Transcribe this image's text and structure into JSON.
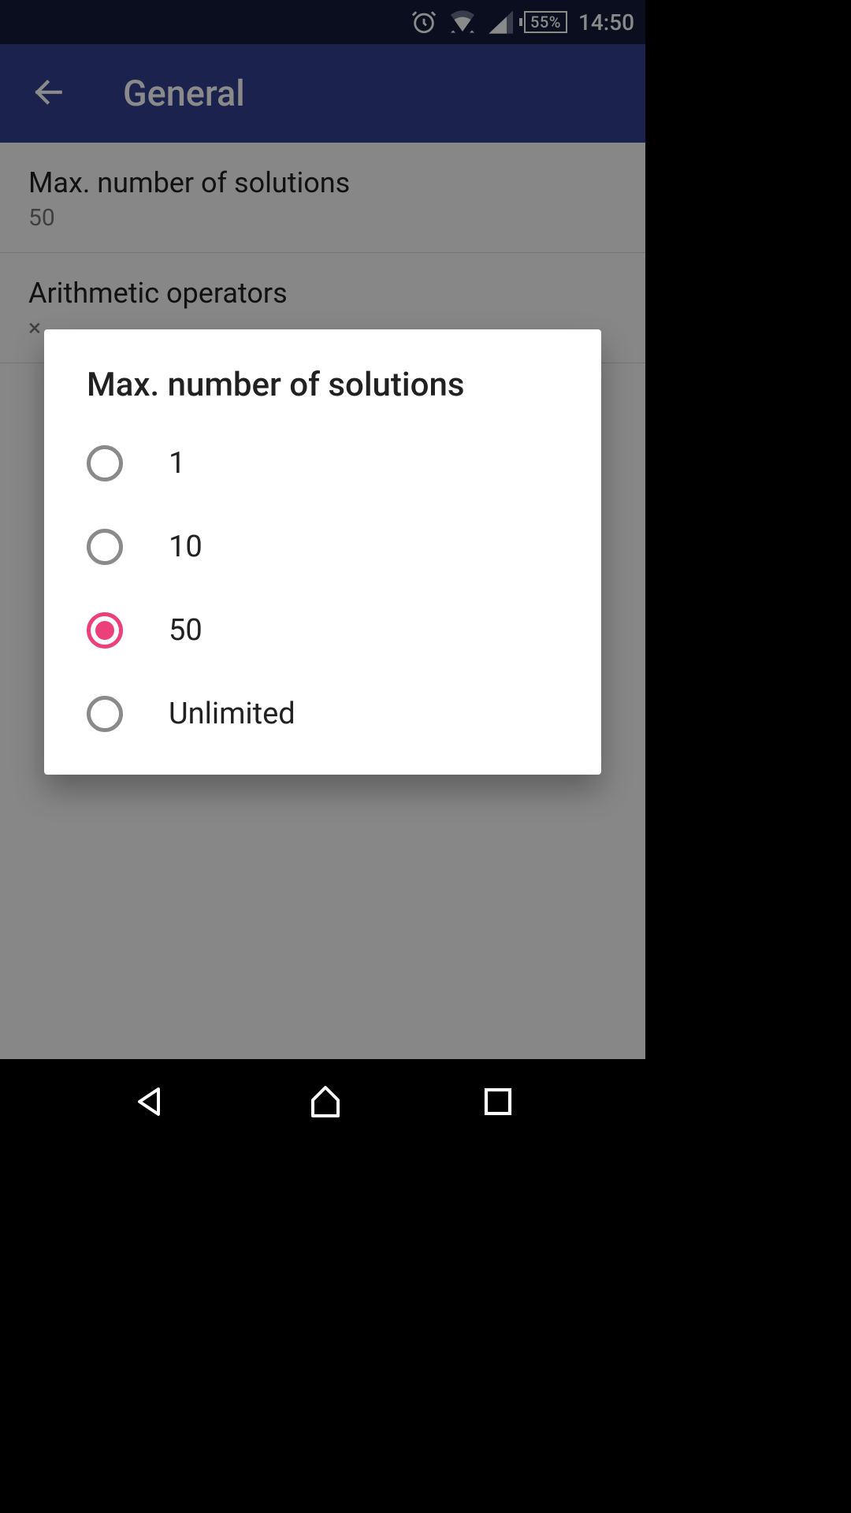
{
  "status": {
    "battery": "55%",
    "time": "14:50"
  },
  "app_bar": {
    "title": "General"
  },
  "settings": {
    "items": [
      {
        "title": "Max. number of solutions",
        "subtitle": "50"
      },
      {
        "title": "Arithmetic operators",
        "subtitle": "×"
      }
    ]
  },
  "dialog": {
    "title": "Max. number of solutions",
    "selected_index": 2,
    "options": [
      {
        "label": "1"
      },
      {
        "label": "10"
      },
      {
        "label": "50"
      },
      {
        "label": "Unlimited"
      }
    ]
  }
}
